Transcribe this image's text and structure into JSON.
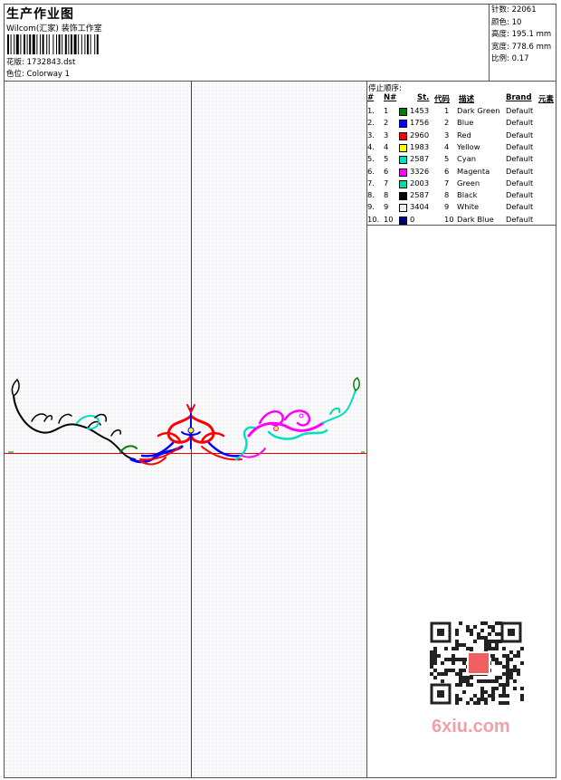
{
  "header": {
    "title": "生产作业图",
    "company": "Wilcom(汇家) 装饰工作室",
    "file_label": "花版: 1732843.dst",
    "colorway_label": "色位: Colorway 1"
  },
  "stats": {
    "stitches": "针数: 22061",
    "colors": "颜色: 10",
    "height": "高度: 195.1 mm",
    "width": "宽度: 778.6 mm",
    "scale": "比例: 0.17"
  },
  "stop_sequence": {
    "title": "停止顺序:",
    "headers": {
      "index": "#",
      "n": "N#",
      "st": "St.",
      "code": "代码",
      "desc": "描述",
      "brand": "Brand",
      "element": "元素"
    },
    "rows": [
      {
        "idx": "1.",
        "n": "1",
        "st": "1453",
        "code": "1",
        "desc": "Dark Green",
        "brand": "Default",
        "color": "#008000"
      },
      {
        "idx": "2.",
        "n": "2",
        "st": "1756",
        "code": "2",
        "desc": "Blue",
        "brand": "Default",
        "color": "#0000ff"
      },
      {
        "idx": "3.",
        "n": "3",
        "st": "2960",
        "code": "3",
        "desc": "Red",
        "brand": "Default",
        "color": "#ff0000"
      },
      {
        "idx": "4.",
        "n": "4",
        "st": "1983",
        "code": "4",
        "desc": "Yellow",
        "brand": "Default",
        "color": "#ffff00"
      },
      {
        "idx": "5.",
        "n": "5",
        "st": "2587",
        "code": "5",
        "desc": "Cyan",
        "brand": "Default",
        "color": "#00e0c0"
      },
      {
        "idx": "6.",
        "n": "6",
        "st": "3326",
        "code": "6",
        "desc": "Magenta",
        "brand": "Default",
        "color": "#ff00ff"
      },
      {
        "idx": "7.",
        "n": "7",
        "st": "2003",
        "code": "7",
        "desc": "Green",
        "brand": "Default",
        "color": "#00e0a0"
      },
      {
        "idx": "8.",
        "n": "8",
        "st": "2587",
        "code": "8",
        "desc": "Black",
        "brand": "Default",
        "color": "#000000"
      },
      {
        "idx": "9.",
        "n": "9",
        "st": "3404",
        "code": "9",
        "desc": "White",
        "brand": "Default",
        "color": "#f0f0f0"
      },
      {
        "idx": "10.",
        "n": "10",
        "st": "0",
        "code": "10",
        "desc": "Dark Blue",
        "brand": "Default",
        "color": "#000080"
      }
    ]
  },
  "watermark": "6xiu.com"
}
